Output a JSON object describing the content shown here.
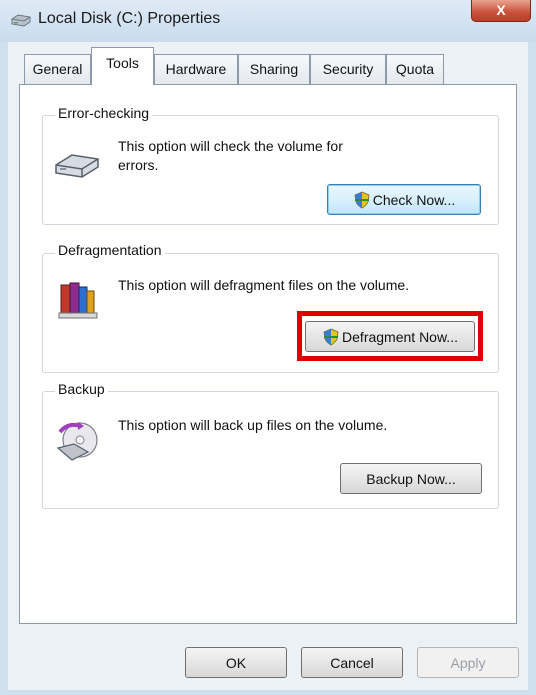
{
  "window": {
    "title": "Local Disk (C:) Properties",
    "close_symbol": "X"
  },
  "tabs": [
    {
      "label": "General",
      "active": false
    },
    {
      "label": "Tools",
      "active": true
    },
    {
      "label": "Hardware",
      "active": false
    },
    {
      "label": "Sharing",
      "active": false
    },
    {
      "label": "Security",
      "active": false
    },
    {
      "label": "Quota",
      "active": false
    }
  ],
  "error_checking": {
    "title": "Error-checking",
    "description_line1": "This option will check the volume for",
    "description_line2": "errors.",
    "button": "Check Now...",
    "icon": "drive-icon"
  },
  "defragmentation": {
    "title": "Defragmentation",
    "description": "This option will defragment files on the volume.",
    "button": "Defragment Now...",
    "icon": "defrag-icon",
    "highlight_color": "#e00000"
  },
  "backup": {
    "title": "Backup",
    "description": "This option will back up files on the volume.",
    "button": "Backup Now...",
    "icon": "backup-icon"
  },
  "footer": {
    "ok": "OK",
    "cancel": "Cancel",
    "apply": "Apply"
  }
}
